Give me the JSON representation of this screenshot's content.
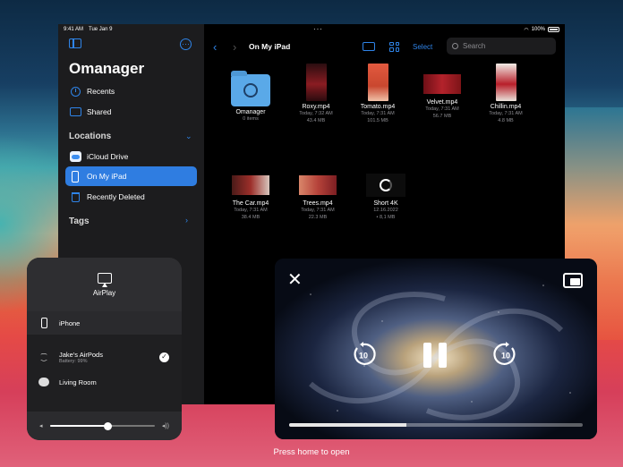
{
  "status_bar": {
    "time": "9:41 AM",
    "date": "Tue Jan 9",
    "battery": "100%"
  },
  "sidebar": {
    "app_title": "Omanager",
    "items": [
      {
        "label": "Recents",
        "icon": "clock-icon"
      },
      {
        "label": "Shared",
        "icon": "shared-folder-icon"
      }
    ],
    "locations_header": "Locations",
    "locations": [
      {
        "label": "iCloud Drive",
        "icon": "cloud-icon",
        "active": false
      },
      {
        "label": "On My iPad",
        "icon": "ipad-icon",
        "active": true
      },
      {
        "label": "Recently Deleted",
        "icon": "trash-icon",
        "active": false
      }
    ],
    "tags_header": "Tags"
  },
  "toolbar": {
    "path_title": "On My iPad",
    "select_label": "Select",
    "search_placeholder": "Search"
  },
  "files": [
    {
      "name": "Omanager",
      "line1": "0 items",
      "line2": "",
      "kind": "folder"
    },
    {
      "name": "Roxy.mp4",
      "line1": "Today, 7:32 AM",
      "line2": "43.4 MB",
      "kind": "portrait",
      "color": "#8a1c22"
    },
    {
      "name": "Tomato.mp4",
      "line1": "Today, 7:31 AM",
      "line2": "101.5 MB",
      "kind": "portrait",
      "color": "#c9472f"
    },
    {
      "name": "Velvet.mp4",
      "line1": "Today, 7:31 AM",
      "line2": "56.7 MB",
      "kind": "landscape",
      "color": "#b3222b"
    },
    {
      "name": "Chillin.mp4",
      "line1": "Today, 7:31 AM",
      "line2": "4.8 MB",
      "kind": "portrait",
      "color": "#e9e2da"
    },
    {
      "name": "The Car.mp4",
      "line1": "Today, 7:31 AM",
      "line2": "38.4 MB",
      "kind": "landscape",
      "color": "#9d2f2a"
    },
    {
      "name": "Trees.mp4",
      "line1": "Today, 7:31 AM",
      "line2": "22.3 MB",
      "kind": "landscape",
      "color": "#b6433a"
    },
    {
      "name": "Short 4K",
      "line1": "12.16.2022",
      "line2": "• 8,1 MB",
      "kind": "spinner"
    }
  ],
  "airplay": {
    "title": "AirPlay",
    "devices": [
      {
        "name": "iPhone",
        "sub": "",
        "icon": "iphone-icon",
        "selected": false
      },
      {
        "name": "Jake's AirPods",
        "sub": "Battery: 99%",
        "icon": "airpods-icon",
        "selected": true
      },
      {
        "name": "Living Room",
        "sub": "",
        "icon": "homepod-icon",
        "selected": false
      }
    ],
    "volume": 0.55,
    "skip_seconds": "10"
  },
  "pip": {
    "progress": 0.4
  },
  "home_hint": "Press home to open"
}
